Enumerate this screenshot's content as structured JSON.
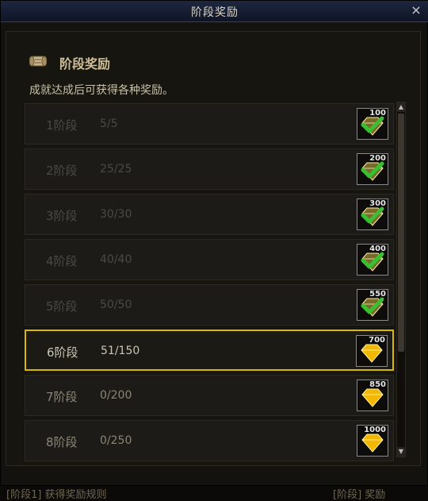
{
  "window": {
    "title": "阶段奖励",
    "close_label": "×"
  },
  "section": {
    "title": "阶段奖励",
    "description": "成就达成后可获得各种奖励。"
  },
  "stages": [
    {
      "name": "1阶段",
      "progress": "5/5",
      "reward": "100",
      "status": "claimed"
    },
    {
      "name": "2阶段",
      "progress": "25/25",
      "reward": "200",
      "status": "claimed"
    },
    {
      "name": "3阶段",
      "progress": "30/30",
      "reward": "300",
      "status": "claimed"
    },
    {
      "name": "4阶段",
      "progress": "40/40",
      "reward": "400",
      "status": "claimed"
    },
    {
      "name": "5阶段",
      "progress": "50/50",
      "reward": "550",
      "status": "claimed"
    },
    {
      "name": "6阶段",
      "progress": "51/150",
      "reward": "700",
      "status": "current"
    },
    {
      "name": "7阶段",
      "progress": "0/200",
      "reward": "850",
      "status": "locked"
    },
    {
      "name": "8阶段",
      "progress": "0/250",
      "reward": "1000",
      "status": "locked"
    }
  ],
  "background": {
    "bottom_text": "[阶段1] 获得奖励规则",
    "bottom_right_text": "[阶段] 奖励"
  },
  "colors": {
    "accent": "#d8b800",
    "check": "#38c030",
    "gem": "#f2b800"
  }
}
